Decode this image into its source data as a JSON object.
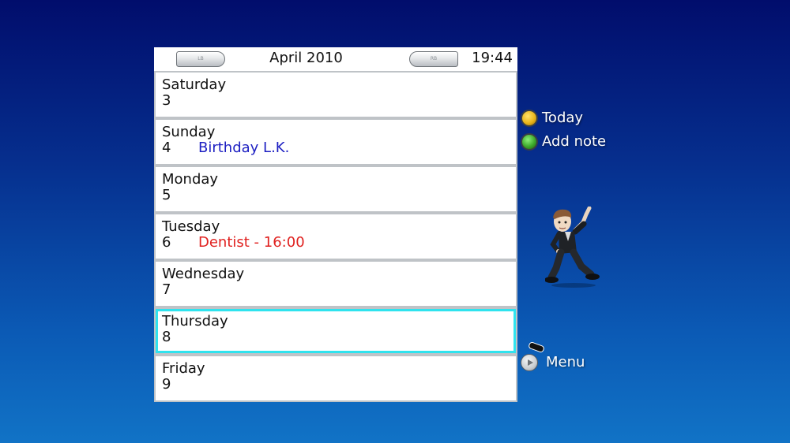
{
  "header": {
    "lb_label": "LB",
    "rb_label": "RB",
    "month": "April 2010",
    "time": "19:44"
  },
  "days": [
    {
      "name": "Saturday",
      "number": "3",
      "event": ""
    },
    {
      "name": "Sunday",
      "number": "4",
      "event": "Birthday L.K."
    },
    {
      "name": "Monday",
      "number": "5",
      "event": ""
    },
    {
      "name": "Tuesday",
      "number": "6",
      "event": "Dentist - 16:00"
    },
    {
      "name": "Wednesday",
      "number": "7",
      "event": ""
    },
    {
      "name": "Thursday",
      "number": "8",
      "event": "",
      "selected": true
    },
    {
      "name": "Friday",
      "number": "9",
      "event": ""
    }
  ],
  "hints": {
    "today": {
      "label": "Today",
      "icon": "y-button-icon"
    },
    "add_note": {
      "label": "Add note",
      "icon": "a-button-icon"
    },
    "menu": {
      "label": "Menu",
      "icon": "start-button-icon"
    }
  },
  "colors": {
    "birthday_event": "#1d1fc2",
    "dentist_event": "#e0211f",
    "selection_border": "#2fe3ee"
  }
}
